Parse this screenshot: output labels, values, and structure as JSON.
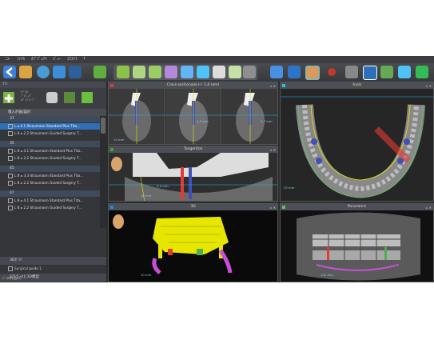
{
  "menubar": {
    "items": [
      "ﾆﾕｰ",
      "ﾌｧｲﾙ",
      "ｵﾌﾞｼﾞｪｸﾄ",
      "ﾋﾞｭｰ",
      "ｴｸｽﾄﾗ",
      "?"
    ]
  },
  "toolbar": {
    "buttons": [
      "back-icon",
      "open-folder-icon",
      "layers-icon",
      "cube-icon",
      "implant-add-icon",
      "implant-move-icon",
      "sleeve-icon",
      "cylinder-icon",
      "crown-icon",
      "tooth-icon",
      "nerve-icon",
      "screenshot-icon",
      "view-icon",
      "scan-icon",
      "face-icon",
      "measure-icon",
      "cut-icon",
      "select-icon",
      "undo-icon",
      "redo-icon"
    ]
  },
  "left_panel": {
    "title": "ｸﾗﾝ",
    "sub_labels": [
      "ﾓﾃﾞﾙ/ﾄ",
      "ﾌﾟﾗﾝﾆﾝｸﾞ",
      "ﾎｿﾞﾝｸﾞﾙｰﾌﾟ"
    ],
    "section_title": "埋入計画/設計",
    "groups": [
      {
        "id": "37",
        "rows": [
          "L ⌀ 4.1  Straumann Standard Plus Tita...",
          "L 8 ⌀ 2.2  Straumann Guided Surgery T..."
        ],
        "selected": 0
      },
      {
        "id": "35",
        "rows": [
          "L 8 ⌀ 4.1  Straumann Standard Plus Tita...",
          "L 8 ⌀ 2.2  Straumann Guided Surgery T..."
        ]
      },
      {
        "id": "45",
        "rows": [
          "L 8 ⌀ 3.3  Straumann Standard Plus Tita...",
          "L 8 ⌀ 2.2  Straumann Guided Surgery T..."
        ]
      },
      {
        "id": "47",
        "rows": [
          "L 8 ⌀ 4.1  Straumann Standard Plus Tita...",
          "L 8 ⌀ 2.2  Straumann Guided Surgery T..."
        ]
      }
    ],
    "guide_section": "3Dｶﾞｲﾄﾞ",
    "guide_item": "Surgical guide 1",
    "stl_section": "STLﾃﾞｰﾀと3D模型",
    "status1": "ﾃﾞﾝﾀﾙ作品(0)",
    "status2": "患者を開く"
  },
  "viewports": {
    "cross": {
      "title": "Cross-sectionals(+/- 1,0 mm)",
      "scales": [
        "10 mm",
        "4,5 mm",
        "1,7 mm"
      ]
    },
    "axial": {
      "title": "Axial",
      "scales": [
        "20 mm"
      ]
    },
    "tangential": {
      "title": "Tangential",
      "scales": [
        "10 mm",
        "4,5 mm"
      ]
    },
    "three_d": {
      "title": "3D",
      "scales": [
        "10 mm"
      ]
    },
    "panoramic": {
      "title": "Panoramic",
      "scales": [
        "100 mm"
      ]
    }
  },
  "colors": {
    "accent_blue": "#2f6fb8",
    "cross_indicator": "#e53935",
    "axial_indicator": "#26c6da",
    "tangential_indicator": "#43a047",
    "three_d_indicator": "#1e88e5",
    "pano_indicator": "#66bb6a",
    "implant_yellow": "#e6e600",
    "guide_purple": "#c64fd6"
  }
}
